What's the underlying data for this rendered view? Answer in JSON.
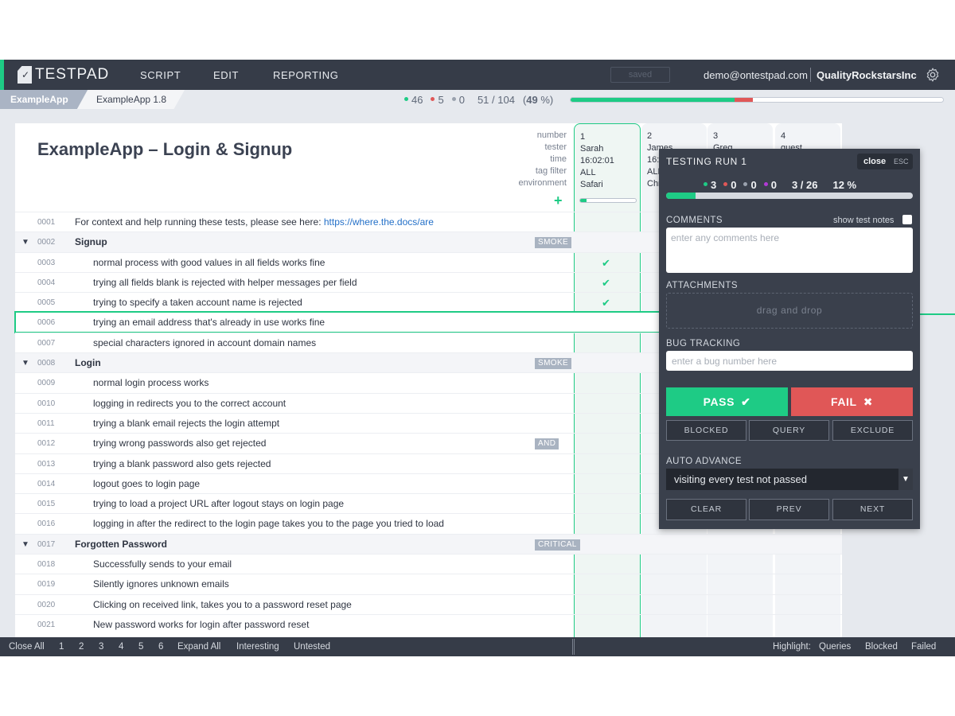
{
  "app": {
    "logo_text": "TESTPAD",
    "nav": [
      "SCRIPT",
      "EDIT",
      "REPORTING"
    ],
    "saved_label": "saved",
    "user_email": "demo@ontestpad.com",
    "org": "QualityRockstarsInc",
    "accent": "#1ecb85"
  },
  "breadcrumb": {
    "project": "ExampleApp",
    "folder": "ExampleApp 1.8"
  },
  "summary": {
    "pass": "46",
    "fail": "5",
    "other": "0",
    "progress": "51 / 104",
    "percent_open": "(",
    "percent": "49",
    "percent_close": " %)",
    "pass_fraction": 0.44,
    "fail_fraction": 0.05
  },
  "script": {
    "title": "ExampleApp – Login & Signup",
    "meta_labels": [
      "number",
      "tester",
      "time",
      "tag filter",
      "environment"
    ],
    "add_label": "+"
  },
  "runs": [
    {
      "number": "1",
      "tester": "Sarah",
      "time": "16:02:01",
      "tag_filter": "ALL",
      "environment": "Safari",
      "progress": 0.12
    },
    {
      "number": "2",
      "tester": "James",
      "time": "16:",
      "tag_filter": "ALL",
      "environment": "Chr"
    },
    {
      "number": "3",
      "tester": "Greg"
    },
    {
      "number": "4",
      "tester": "guest"
    }
  ],
  "rows": [
    {
      "num": "0001",
      "kind": "ctx",
      "text": "For context and help running these tests, please see here: ",
      "link": "https://where.the.docs/are"
    },
    {
      "num": "0002",
      "kind": "grp",
      "text": "Signup",
      "tag": "SMOKE"
    },
    {
      "num": "0003",
      "text": "normal process with good values in all fields works fine",
      "result": "✔"
    },
    {
      "num": "0004",
      "text": "trying all fields blank is rejected with helper messages per field",
      "result": "✔"
    },
    {
      "num": "0005",
      "text": "trying to specify a taken account name is rejected",
      "result": "✔"
    },
    {
      "num": "0006",
      "text": "trying an email address that's already in use works fine",
      "active": true
    },
    {
      "num": "0007",
      "text": "special characters ignored in account domain names"
    },
    {
      "num": "0008",
      "kind": "grp",
      "text": "Login",
      "tag": "SMOKE"
    },
    {
      "num": "0009",
      "text": "normal login process works"
    },
    {
      "num": "0010",
      "text": "logging in redirects you to the correct account"
    },
    {
      "num": "0011",
      "text": "trying a blank email rejects the login attempt"
    },
    {
      "num": "0012",
      "text": "trying wrong passwords also get rejected",
      "tag": "AND"
    },
    {
      "num": "0013",
      "text": "trying a blank password also gets rejected"
    },
    {
      "num": "0014",
      "text": "logout goes to login page"
    },
    {
      "num": "0015",
      "text": "trying to load a project URL after logout stays on login page"
    },
    {
      "num": "0016",
      "text": "logging in after the redirect to the login page takes you to the page you tried to load"
    },
    {
      "num": "0017",
      "kind": "grp",
      "text": "Forgotten Password",
      "tag": "CRITICAL"
    },
    {
      "num": "0018",
      "text": "Successfully sends to your email"
    },
    {
      "num": "0019",
      "text": "Silently ignores unknown emails"
    },
    {
      "num": "0020",
      "text": "Clicking on received link, takes you to a password reset page"
    },
    {
      "num": "0021",
      "text": "New password works for login after password reset"
    }
  ],
  "panel": {
    "title": "TESTING RUN 1",
    "close": "close",
    "esc": "ESC",
    "pass": "3",
    "fail": "0",
    "other": "0",
    "purple": "0",
    "progress": "3 / 26",
    "percent": "12 %",
    "progress_fraction": 0.12,
    "comments_label": "COMMENTS",
    "show_notes": "show test notes",
    "comments_placeholder": "enter any comments here",
    "attachments_label": "ATTACHMENTS",
    "drop_label": "drag and drop",
    "bug_label": "BUG TRACKING",
    "bug_placeholder": "enter a bug number here",
    "pass_btn": "PASS",
    "fail_btn": "FAIL",
    "blocked": "BLOCKED",
    "query": "QUERY",
    "exclude": "EXCLUDE",
    "auto_label": "AUTO ADVANCE",
    "auto_value": "visiting every test not passed",
    "clear": "CLEAR",
    "prev": "PREV",
    "next": "NEXT"
  },
  "bottom": {
    "close_all": "Close All",
    "levels": [
      "1",
      "2",
      "3",
      "4",
      "5",
      "6"
    ],
    "expand_all": "Expand All",
    "interesting": "Interesting",
    "untested": "Untested",
    "highlight": "Highlight:",
    "queries": "Queries",
    "blocked": "Blocked",
    "failed": "Failed"
  }
}
